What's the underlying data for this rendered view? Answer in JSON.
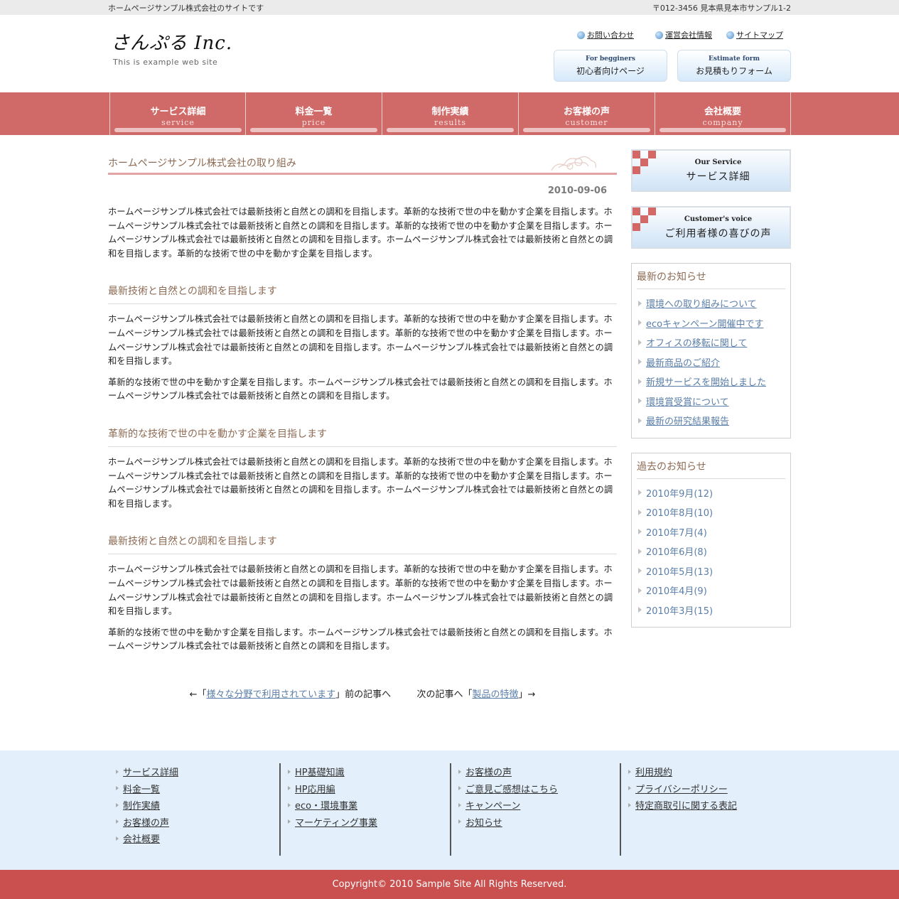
{
  "topbar": {
    "left": "ホームページサンプル株式会社のサイトです",
    "right": "〒012-3456 見本県見本市サンプル1-2"
  },
  "logo": {
    "name": "さんぷる Inc.",
    "tagline": "This is example web site"
  },
  "header_links": [
    {
      "label": "お問い合わせ"
    },
    {
      "label": "運営会社情報"
    },
    {
      "label": "サイトマップ"
    }
  ],
  "header_buttons": [
    {
      "en": "For begginers",
      "jp": "初心者向けページ"
    },
    {
      "en": "Estimate form",
      "jp": "お見積もりフォーム"
    }
  ],
  "nav": [
    {
      "jp": "サービス詳細",
      "en": "service"
    },
    {
      "jp": "料金一覧",
      "en": "price"
    },
    {
      "jp": "制作実績",
      "en": "results"
    },
    {
      "jp": "お客様の声",
      "en": "customer"
    },
    {
      "jp": "会社概要",
      "en": "company"
    }
  ],
  "article": {
    "title": "ホームページサンプル株式会社の取り組み",
    "date": "2010-09-06",
    "intro": "ホームページサンプル株式会社では最新技術と自然との調和を目指します。革新的な技術で世の中を動かす企業を目指します。ホームページサンプル株式会社では最新技術と自然との調和を目指します。革新的な技術で世の中を動かす企業を目指します。ホームページサンプル株式会社では最新技術と自然との調和を目指します。ホームページサンプル株式会社では最新技術と自然との調和を目指します。革新的な技術で世の中を動かす企業を目指します。",
    "sections": [
      {
        "heading": "最新技術と自然との調和を目指します",
        "p1": "ホームページサンプル株式会社では最新技術と自然との調和を目指します。革新的な技術で世の中を動かす企業を目指します。ホームページサンプル株式会社では最新技術と自然との調和を目指します。革新的な技術で世の中を動かす企業を目指します。ホームページサンプル株式会社では最新技術と自然との調和を目指します。ホームページサンプル株式会社では最新技術と自然との調和を目指します。",
        "p2": "革新的な技術で世の中を動かす企業を目指します。ホームページサンプル株式会社では最新技術と自然との調和を目指します。ホームページサンプル株式会社では最新技術と自然との調和を目指します。"
      },
      {
        "heading": "革新的な技術で世の中を動かす企業を目指します",
        "p1": "ホームページサンプル株式会社では最新技術と自然との調和を目指します。革新的な技術で世の中を動かす企業を目指します。ホームページサンプル株式会社では最新技術と自然との調和を目指します。革新的な技術で世の中を動かす企業を目指します。ホームページサンプル株式会社では最新技術と自然との調和を目指します。ホームページサンプル株式会社では最新技術と自然との調和を目指します。"
      },
      {
        "heading": "最新技術と自然との調和を目指します",
        "p1": "ホームページサンプル株式会社では最新技術と自然との調和を目指します。革新的な技術で世の中を動かす企業を目指します。ホームページサンプル株式会社では最新技術と自然との調和を目指します。革新的な技術で世の中を動かす企業を目指します。ホームページサンプル株式会社では最新技術と自然との調和を目指します。ホームページサンプル株式会社では最新技術と自然との調和を目指します。",
        "p2": "革新的な技術で世の中を動かす企業を目指します。ホームページサンプル株式会社では最新技術と自然との調和を目指します。ホームページサンプル株式会社では最新技術と自然との調和を目指します。"
      }
    ]
  },
  "side_banners": [
    {
      "en": "Our Service",
      "jp": "サービス詳細"
    },
    {
      "en": "Customer's voice",
      "jp": "ご利用者様の喜びの声"
    }
  ],
  "news": {
    "title": "最新のお知らせ",
    "items": [
      "環境への取り組みについて",
      "ecoキャンペーン開催中です",
      "オフィスの移転に関して",
      "最新商品のご紹介",
      "新規サービスを開始しました",
      "環境賞受賞について",
      "最新の研究結果報告"
    ]
  },
  "archive": {
    "title": "過去のお知らせ",
    "items": [
      "2010年9月(12)",
      "2010年8月(10)",
      "2010年7月(4)",
      "2010年6月(8)",
      "2010年5月(13)",
      "2010年4月(9)",
      "2010年3月(15)"
    ]
  },
  "pager": {
    "prev_pre": "←「",
    "prev_link": "様々な分野で利用されています",
    "prev_post": "」前の記事へ",
    "next_pre": "次の記事へ「",
    "next_link": "製品の特徴",
    "next_post": "」→"
  },
  "footer": {
    "col1": [
      "サービス詳細",
      "料金一覧",
      "制作実績",
      "お客様の声",
      "会社概要"
    ],
    "col2": [
      "HP基礎知識",
      "HP応用編",
      "eco・環境事業",
      "マーケティング事業"
    ],
    "col3": [
      "お客様の声",
      "ご意見ご感想はこちら",
      "キャンペーン",
      "お知らせ"
    ],
    "col4": [
      "利用規約",
      "プライバシーポリシー",
      "特定商取引に関する表記"
    ],
    "copyright": "Copyright© 2010 Sample Site All Rights Reserved."
  },
  "colors": {
    "nav": "#d06a68",
    "footer_bg": "#e3f0fb",
    "copyright_bg": "#c9504f",
    "heading": "#8d6b54",
    "link": "#5a7ea8"
  }
}
